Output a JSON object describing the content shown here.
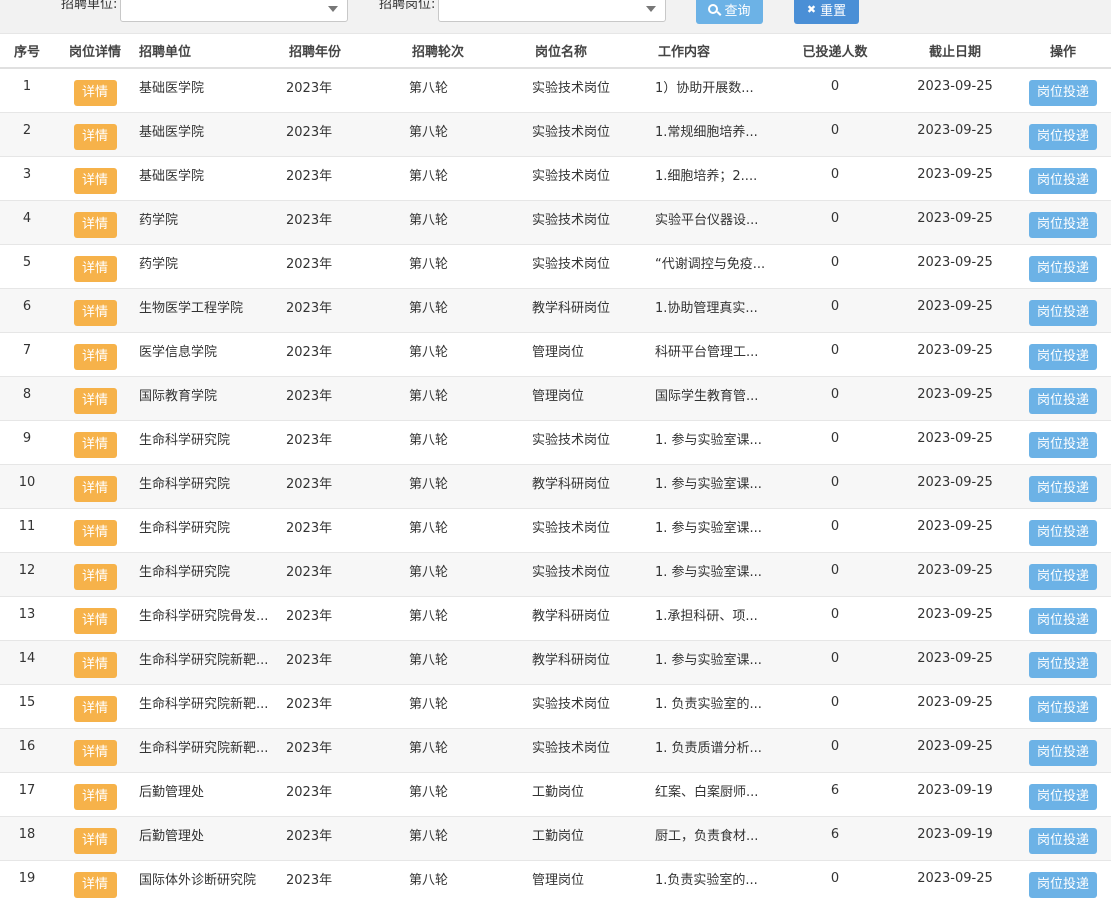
{
  "filters": {
    "unit_label": "招聘单位:",
    "post_label": "招聘岗位:",
    "unit_value": "",
    "post_value": "",
    "search_label": "查询",
    "reset_label": "重置"
  },
  "table": {
    "headers": {
      "idx": "序号",
      "detail": "岗位详情",
      "unit": "招聘单位",
      "year": "招聘年份",
      "round": "招聘轮次",
      "post": "岗位名称",
      "content": "工作内容",
      "count": "已投递人数",
      "deadline": "截止日期",
      "op": "操作"
    },
    "detail_label": "详情",
    "apply_label": "岗位投递",
    "rows": [
      {
        "idx": "1",
        "unit": "基础医学院",
        "year": "2023年",
        "round": "第八轮",
        "post": "实验技术岗位",
        "content": "1）协助开展数...",
        "count": "0",
        "deadline": "2023-09-25"
      },
      {
        "idx": "2",
        "unit": "基础医学院",
        "year": "2023年",
        "round": "第八轮",
        "post": "实验技术岗位",
        "content": "1.常规细胞培养...",
        "count": "0",
        "deadline": "2023-09-25"
      },
      {
        "idx": "3",
        "unit": "基础医学院",
        "year": "2023年",
        "round": "第八轮",
        "post": "实验技术岗位",
        "content": "1.细胞培养；2....",
        "count": "0",
        "deadline": "2023-09-25"
      },
      {
        "idx": "4",
        "unit": "药学院",
        "year": "2023年",
        "round": "第八轮",
        "post": "实验技术岗位",
        "content": "实验平台仪器设...",
        "count": "0",
        "deadline": "2023-09-25"
      },
      {
        "idx": "5",
        "unit": "药学院",
        "year": "2023年",
        "round": "第八轮",
        "post": "实验技术岗位",
        "content": "“代谢调控与免疫...",
        "count": "0",
        "deadline": "2023-09-25"
      },
      {
        "idx": "6",
        "unit": "生物医学工程学院",
        "year": "2023年",
        "round": "第八轮",
        "post": "教学科研岗位",
        "content": "1.协助管理真实...",
        "count": "0",
        "deadline": "2023-09-25"
      },
      {
        "idx": "7",
        "unit": "医学信息学院",
        "year": "2023年",
        "round": "第八轮",
        "post": "管理岗位",
        "content": "科研平台管理工...",
        "count": "0",
        "deadline": "2023-09-25"
      },
      {
        "idx": "8",
        "unit": "国际教育学院",
        "year": "2023年",
        "round": "第八轮",
        "post": "管理岗位",
        "content": "国际学生教育管...",
        "count": "0",
        "deadline": "2023-09-25"
      },
      {
        "idx": "9",
        "unit": "生命科学研究院",
        "year": "2023年",
        "round": "第八轮",
        "post": "实验技术岗位",
        "content": "1. 参与实验室课...",
        "count": "0",
        "deadline": "2023-09-25"
      },
      {
        "idx": "10",
        "unit": "生命科学研究院",
        "year": "2023年",
        "round": "第八轮",
        "post": "教学科研岗位",
        "content": "1. 参与实验室课...",
        "count": "0",
        "deadline": "2023-09-25"
      },
      {
        "idx": "11",
        "unit": "生命科学研究院",
        "year": "2023年",
        "round": "第八轮",
        "post": "实验技术岗位",
        "content": "1. 参与实验室课...",
        "count": "0",
        "deadline": "2023-09-25"
      },
      {
        "idx": "12",
        "unit": "生命科学研究院",
        "year": "2023年",
        "round": "第八轮",
        "post": "实验技术岗位",
        "content": "1. 参与实验室课...",
        "count": "0",
        "deadline": "2023-09-25"
      },
      {
        "idx": "13",
        "unit": "生命科学研究院骨发...",
        "year": "2023年",
        "round": "第八轮",
        "post": "教学科研岗位",
        "content": "1.承担科研、项...",
        "count": "0",
        "deadline": "2023-09-25"
      },
      {
        "idx": "14",
        "unit": "生命科学研究院新靶...",
        "year": "2023年",
        "round": "第八轮",
        "post": "教学科研岗位",
        "content": "1. 参与实验室课...",
        "count": "0",
        "deadline": "2023-09-25"
      },
      {
        "idx": "15",
        "unit": "生命科学研究院新靶...",
        "year": "2023年",
        "round": "第八轮",
        "post": "实验技术岗位",
        "content": "1. 负责实验室的...",
        "count": "0",
        "deadline": "2023-09-25"
      },
      {
        "idx": "16",
        "unit": "生命科学研究院新靶...",
        "year": "2023年",
        "round": "第八轮",
        "post": "实验技术岗位",
        "content": "1. 负责质谱分析...",
        "count": "0",
        "deadline": "2023-09-25"
      },
      {
        "idx": "17",
        "unit": "后勤管理处",
        "year": "2023年",
        "round": "第八轮",
        "post": "工勤岗位",
        "content": "红案、白案厨师...",
        "count": "6",
        "deadline": "2023-09-19"
      },
      {
        "idx": "18",
        "unit": "后勤管理处",
        "year": "2023年",
        "round": "第八轮",
        "post": "工勤岗位",
        "content": "厨工，负责食材...",
        "count": "6",
        "deadline": "2023-09-19"
      },
      {
        "idx": "19",
        "unit": "国际体外诊断研究院",
        "year": "2023年",
        "round": "第八轮",
        "post": "管理岗位",
        "content": "1.负责实验室的...",
        "count": "0",
        "deadline": "2023-09-25"
      }
    ]
  }
}
